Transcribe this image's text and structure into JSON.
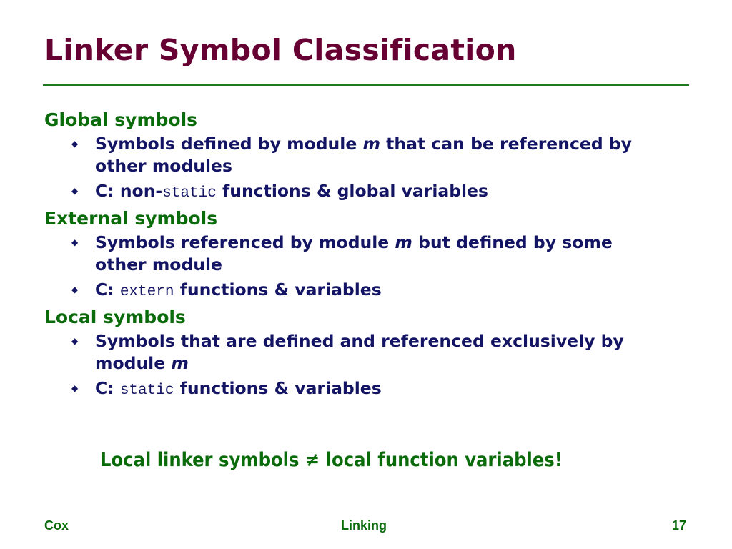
{
  "slide": {
    "title": "Linker Symbol Classification",
    "sections": [
      {
        "heading": "Global symbols",
        "items": [
          {
            "pre": "Symbols defined by module ",
            "em": "m",
            "post": " that can be referenced by other modules"
          },
          {
            "pre": "C: non-",
            "code": "static",
            "post": " functions & global variables"
          }
        ]
      },
      {
        "heading": "External symbols",
        "items": [
          {
            "pre": "Symbols referenced by module ",
            "em": "m",
            "post": " but defined by some other module"
          },
          {
            "pre": "C: ",
            "code": "extern",
            "post": " functions & variables"
          }
        ]
      },
      {
        "heading": "Local symbols",
        "items": [
          {
            "pre": "Symbols that are defined and referenced exclusively by module ",
            "em": "m",
            "post": ""
          },
          {
            "pre": "C: ",
            "code": "static",
            "post": " functions & variables"
          }
        ]
      }
    ],
    "note": "Local linker symbols ≠ local function variables!",
    "bullet_glyph": "◆",
    "footer": {
      "left": "Cox",
      "center": "Linking",
      "right": "17"
    }
  }
}
